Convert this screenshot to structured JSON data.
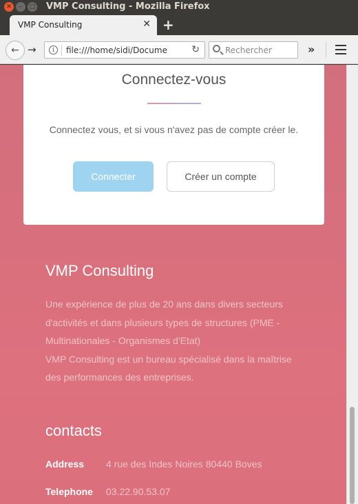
{
  "window": {
    "title": "VMP Consulting - Mozilla Firefox"
  },
  "tabs": [
    {
      "label": "VMP Consulting",
      "close": "✕"
    }
  ],
  "toolbar": {
    "new_tab": "+",
    "url": "file:///home/sidi/Docume",
    "search_placeholder": "Rechercher",
    "overflow": "»"
  },
  "login_card": {
    "title": "Connectez-vous",
    "text": "Connectez vous, et si vous n'avez pas de compte créer le.",
    "connect_button": "Connecter",
    "create_button": "Créer un compte"
  },
  "about": {
    "heading": "VMP Consulting",
    "paragraph1": "Une expérience de plus de 20 ans dans divers secteurs d'activités et dans plusieurs types de structures (PME - Multinationales - Organismes d'Etat)",
    "paragraph2": "VMP Consulting est un bureau spécialisé dans la maîtrise des performances des entreprises."
  },
  "contacts": {
    "heading": "contacts",
    "rows": [
      {
        "label": "Address",
        "value": "4 rue des Indes Noires 80440 Boves"
      },
      {
        "label": "Telephone",
        "value": "03.22.90.53.07"
      }
    ]
  },
  "colors": {
    "page_background": "#d86f7c",
    "connect_button": "#9fd4f0",
    "muted_text": "#f2c3c8"
  }
}
